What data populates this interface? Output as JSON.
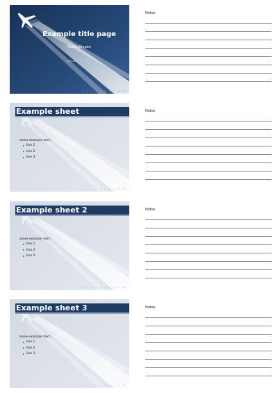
{
  "notes_label": "Notes",
  "title_slide": {
    "title": "Example title page",
    "author": "Guido Diepen",
    "date": "January 6, 2007"
  },
  "sheets": [
    {
      "title": "Example sheet",
      "intro": "some example text:",
      "items": [
        "line 1",
        "line 2",
        "line 3"
      ]
    },
    {
      "title": "Example sheet 2",
      "intro": "some example text:",
      "items": [
        "line 1",
        "line 2",
        "line 3"
      ]
    },
    {
      "title": "Example sheet 3",
      "intro": "some example text:",
      "items": [
        "line 1",
        "line 2",
        "line 3"
      ]
    }
  ],
  "colors": {
    "slide_dark_blue": "#1f3a63",
    "slide_light_bg": "#dfe3ea",
    "notes_line": "#8a8a8a"
  },
  "icons": {
    "slide_bullet": "triangle-bullet-icon",
    "slide_navigation": "navigation-symbols-icon",
    "background_image": "airplane-contrail-image"
  }
}
